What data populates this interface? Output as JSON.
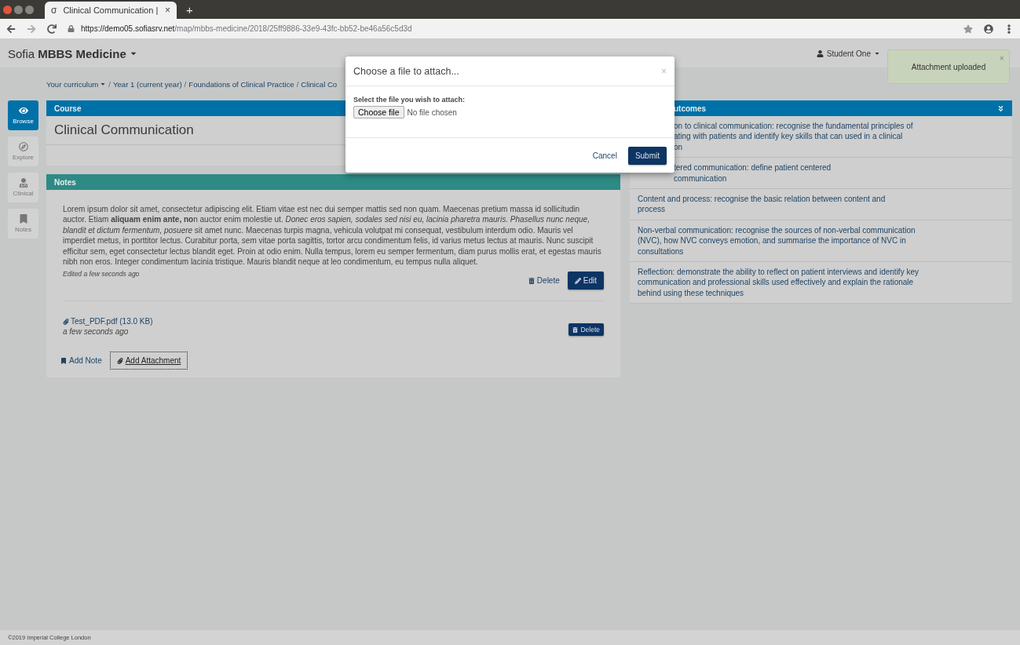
{
  "browser": {
    "site_icon": "σ",
    "tab_title": "Clinical Communication |",
    "close_tab": "×",
    "new_tab": "+",
    "url_host": "https://demo05.sofiasrv.net",
    "url_path": "/map/mbbs-medicine/2018/25ff9886-33e9-43fc-bb52-be46a56c5d3d"
  },
  "header": {
    "brand": "Sofia",
    "product": "MBBS Medicine",
    "user": "Student One"
  },
  "toast": {
    "text": "Attachment uploaded",
    "close": "×"
  },
  "breadcrumb": {
    "separator": "/",
    "items": [
      {
        "label": "Your curriculum",
        "dropdown": true
      },
      {
        "label": "Year 1 (current year)",
        "dropdown": false
      },
      {
        "label": "Foundations of Clinical Practice",
        "dropdown": false
      },
      {
        "label": "Clinical Co",
        "dropdown": false
      }
    ]
  },
  "sidebar": [
    {
      "label": "Browse",
      "selected": true
    },
    {
      "label": "Explore",
      "selected": false
    },
    {
      "label": "Clinical",
      "selected": false
    },
    {
      "label": "Notes",
      "selected": false
    }
  ],
  "course": {
    "heading": "Course",
    "title": "Clinical Communication"
  },
  "notes": {
    "heading": "Notes",
    "text": "Lorem ipsum dolor sit amet, consectetur adipiscing elit. Etiam vitae est nec dui semper mattis sed non quam. Maecenas pretium massa id sollicitudin auctor. Etiam **aliquam enim ante, no**n auctor enim molestie ut. *Donec eros sapien, sodales sed nisi eu, lacinia pharetra mauris. Phasellus nunc neque, blandit et dictum fermentum, posuere* sit amet nunc. Maecenas turpis magna, vehicula volutpat mi consequat, vestibulum interdum odio. Mauris vel imperdiet metus, in porttitor lectus. Curabitur porta, sem vitae porta sagittis, tortor arcu condimentum felis, id varius metus lectus at mauris. Nunc suscipit efficitur sem, eget consectetur lectus blandit eget. Proin at odio enim. Nulla tempus, lorem eu semper fermentum, diam purus mollis erat, et egestas mauris nibh non eros. Integer condimentum lacinia tristique. Mauris blandit neque at leo condimentum, eu tempus nulla aliquet.",
    "edited": "Edited a few seconds ago",
    "delete": "Delete",
    "edit": "Edit",
    "attachment": {
      "name": "Test_PDF.pdf (13.0 KB)",
      "time": "a few seconds ago",
      "delete": "Delete"
    },
    "add_note": "Add Note",
    "add_attachment": "Add Attachment"
  },
  "outcomes": {
    "heading": "utcomes",
    "items": [
      {
        "text": "on to clinical communication: recognise the fundamental principles of\nating with patients and identify key skills that can used in a clinical\non",
        "covered": true
      },
      {
        "text": "tered communication: define patient centered\ncommunication",
        "covered": true
      },
      {
        "text": "Content and process: recognise the basic relation between content and\nprocess",
        "covered": false
      },
      {
        "text": "Non-verbal communication: recognise the sources of non-verbal communication\n(NVC), how NVC conveys emotion, and summarise the importance of NVC in\nconsultations",
        "covered": false
      },
      {
        "text": "Reflection: demonstrate the ability to reflect on patient interviews and identify key\ncommunication and professional skills used effectively and explain the rationale\nbehind using these techniques",
        "covered": false
      }
    ]
  },
  "modal": {
    "title": "Choose a file to attach...",
    "close": "×",
    "label": "Select the file you wish to attach:",
    "choose": "Choose file",
    "no_file": "No file chosen",
    "cancel": "Cancel",
    "submit": "Submit"
  },
  "footer": "©2019 Imperial College London"
}
